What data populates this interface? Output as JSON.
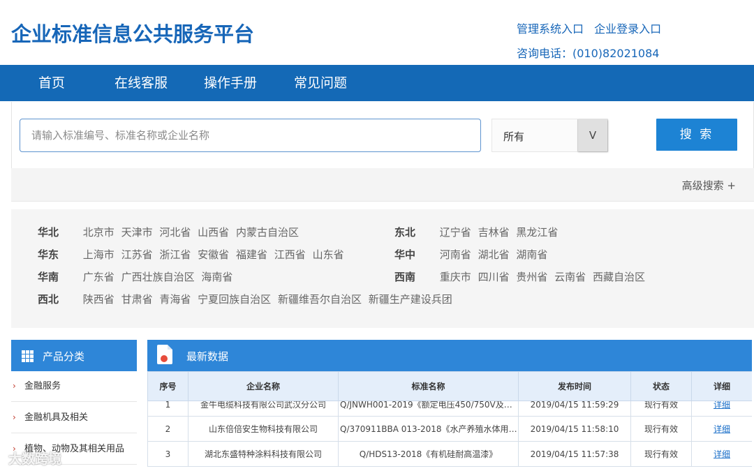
{
  "header": {
    "site_title": "企业标准信息公共服务平台",
    "link_admin": "管理系统入口",
    "link_login": "企业登录入口",
    "hotline": "咨询电话：(010)82021084"
  },
  "nav": {
    "items": [
      "首页",
      "在线客服",
      "操作手册",
      "常见问题"
    ]
  },
  "search": {
    "placeholder": "请输入标准编号、标准名称或企业名称",
    "select_value": "所有",
    "select_toggle": "V",
    "button": "搜 索",
    "advanced": "高级搜索 +"
  },
  "regions": [
    {
      "name": "华北",
      "provinces": [
        "北京市",
        "天津市",
        "河北省",
        "山西省",
        "内蒙古自治区"
      ]
    },
    {
      "name": "东北",
      "provinces": [
        "辽宁省",
        "吉林省",
        "黑龙江省"
      ]
    },
    {
      "name": "华东",
      "provinces": [
        "上海市",
        "江苏省",
        "浙江省",
        "安徽省",
        "福建省",
        "江西省",
        "山东省"
      ]
    },
    {
      "name": "华中",
      "provinces": [
        "河南省",
        "湖北省",
        "湖南省"
      ]
    },
    {
      "name": "华南",
      "provinces": [
        "广东省",
        "广西壮族自治区",
        "海南省"
      ]
    },
    {
      "name": "西南",
      "provinces": [
        "重庆市",
        "四川省",
        "贵州省",
        "云南省",
        "西藏自治区"
      ]
    },
    {
      "name": "西北",
      "provinces": [
        "陕西省",
        "甘肃省",
        "青海省",
        "宁夏回族自治区",
        "新疆维吾尔自治区",
        "新疆生产建设兵团"
      ]
    }
  ],
  "categories": {
    "title": "产品分类",
    "items": [
      "金融服务",
      "金融机具及相关",
      "植物、动物及其相关用品"
    ]
  },
  "latest": {
    "title": "最新数据",
    "columns": [
      "序号",
      "企业名称",
      "标准名称",
      "发布时间",
      "状态",
      "详细"
    ],
    "rows": [
      {
        "no": "1",
        "company": "金牛电缆科技有限公司武汉分公司",
        "standard": "Q/JNWH001-2019《额定电压450/750V及以...",
        "date": "2019/04/15 11:59:29",
        "status": "现行有效",
        "detail": "详细"
      },
      {
        "no": "2",
        "company": "山东倍倍安生物科技有限公司",
        "standard": "Q/370911BBA 013-2018《水产养殖水体用五...",
        "date": "2019/04/15 11:58:10",
        "status": "现行有效",
        "detail": "详细"
      },
      {
        "no": "3",
        "company": "湖北东盛特种涂料科技有限公司",
        "standard": "Q/HDS13-2018《有机硅耐高温漆》",
        "date": "2019/04/15 11:57:38",
        "status": "现行有效",
        "detail": "详细"
      }
    ]
  },
  "watermark": "大数跨境",
  "colors": {
    "brand_blue": "#1469b6",
    "accent_blue": "#2e86d8",
    "link_blue": "#1a6fc9"
  }
}
